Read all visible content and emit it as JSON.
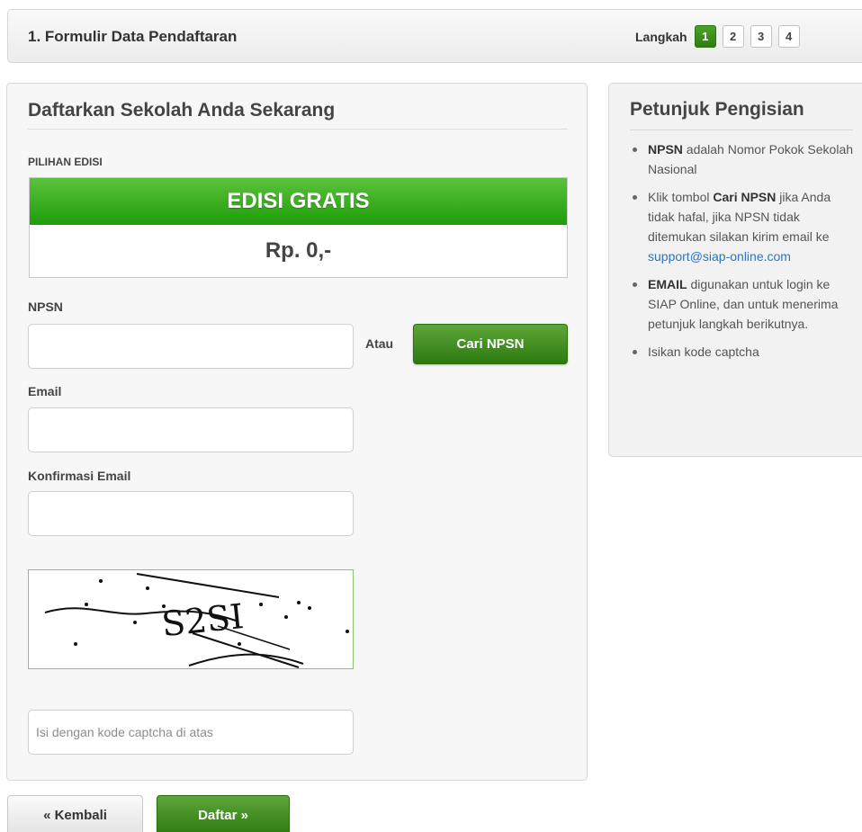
{
  "steps": {
    "title": "1. Formulir Data Pendaftaran",
    "label": "Langkah",
    "items": [
      "1",
      "2",
      "3",
      "4"
    ],
    "active_index": 0
  },
  "form": {
    "title": "Daftarkan Sekolah Anda Sekarang",
    "edition_label": "PILIHAN EDISI",
    "edition_name": "EDISI GRATIS",
    "edition_price": "Rp. 0,-",
    "npsn_label": "NPSN",
    "npsn_value": "",
    "atau_label": "Atau",
    "cari_button": "Cari NPSN",
    "email_label": "Email",
    "email_value": "",
    "confirm_email_label": "Konfirmasi Email",
    "confirm_email_value": "",
    "captcha_text": "S2SI",
    "captcha_value": "",
    "captcha_placeholder": "Isi dengan kode captcha di atas"
  },
  "help": {
    "title": "Petunjuk Pengisian",
    "items": [
      {
        "bold": "NPSN",
        "text": " adalah Nomor Pokok Sekolah Nasional"
      },
      {
        "pre": "Klik tombol ",
        "bold": "Cari NPSN",
        "text": " jika Anda tidak hafal, jika NPSN tidak ditemukan silakan kirim email ke ",
        "link": "support@siap-online.com"
      },
      {
        "bold": "EMAIL",
        "text": " digunakan untuk login ke SIAP Online, dan untuk menerima petunjuk langkah berikutnya."
      },
      {
        "text": "Isikan kode captcha"
      }
    ]
  },
  "buttons": {
    "back": "« Kembali",
    "submit": "Daftar »"
  },
  "colors": {
    "accent_green": "#2d7a10",
    "edition_green": "#1e9d0a",
    "link_blue": "#2b74c8"
  }
}
